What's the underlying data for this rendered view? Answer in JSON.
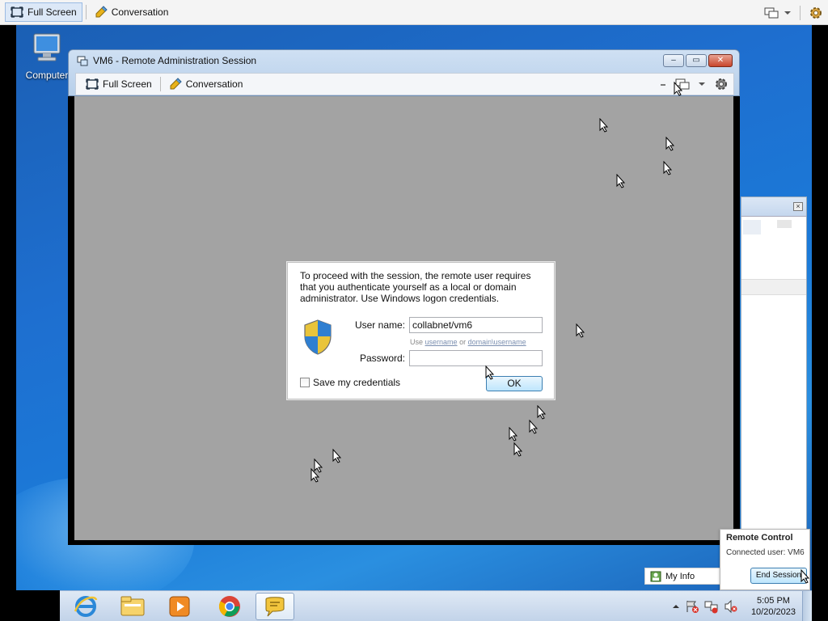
{
  "outer_toolbar": {
    "full_screen_label": "Full Screen",
    "conversation_label": "Conversation"
  },
  "desktop": {
    "icons": [
      {
        "label": "Computer",
        "icon": "computer-icon"
      }
    ]
  },
  "session_window": {
    "title": "VM6 - Remote Administration Session",
    "toolbar": {
      "full_screen_label": "Full Screen",
      "conversation_label": "Conversation"
    }
  },
  "auth_dialog": {
    "message": "To proceed with the session, the remote user requires that you authenticate yourself as a local or domain administrator. Use Windows logon credentials.",
    "username_label": "User name:",
    "username_value": "collabnet/vm6",
    "hint_prefix": "Use",
    "hint_username": "username",
    "hint_or": "or",
    "hint_domain_username": "domain\\username",
    "password_label": "Password:",
    "password_value": "",
    "save_credentials_label": "Save my credentials",
    "save_credentials_checked": false,
    "ok_label": "OK"
  },
  "remote_control_popup": {
    "title": "Remote Control",
    "connected_user_label": "Connected user: VM6",
    "end_session_label": "End Session"
  },
  "my_info_label": "My Info",
  "taskbar": {
    "apps": [
      "internet-explorer-icon",
      "file-explorer-icon",
      "media-player-icon",
      "chrome-icon",
      "chat-icon"
    ],
    "clock_time": "5:05 PM",
    "clock_date": "10/20/2023"
  },
  "colors": {
    "desktop_blue": "#1e6fd0",
    "remote_gray": "#a3a3a3",
    "button_blue": "#bee6fd"
  }
}
